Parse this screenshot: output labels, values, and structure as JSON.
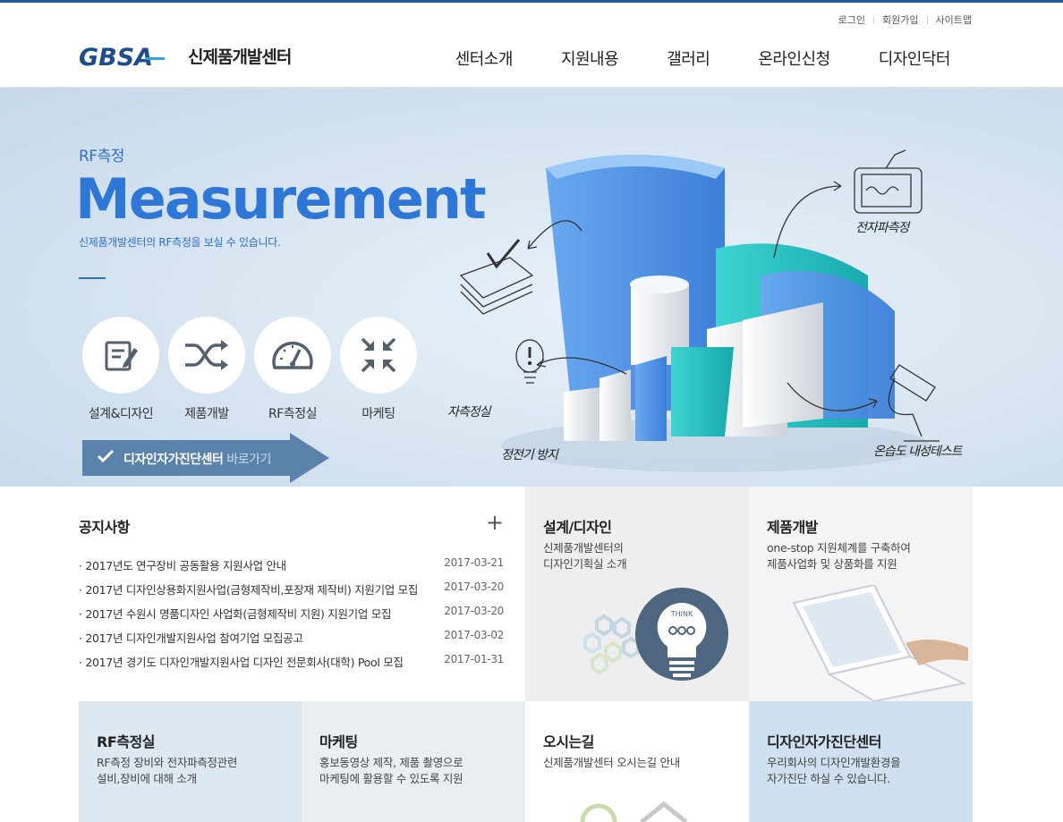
{
  "util_links": [
    "로그인",
    "회원가입",
    "사이트맵"
  ],
  "logo": {
    "mark": "GBSA",
    "text": "신제품개발센터"
  },
  "nav": [
    "센터소개",
    "지원내용",
    "갤러리",
    "온라인신청",
    "디자인닥터"
  ],
  "hero": {
    "subtitle": "RF측정",
    "title": "Measurement",
    "desc": "신제품개발센터의 RF측정을 보실 수 있습니다.",
    "quick": [
      {
        "label": "설계&디자인",
        "icon": "edit-icon"
      },
      {
        "label": "제품개발",
        "icon": "shuffle-icon"
      },
      {
        "label": "RF측정실",
        "icon": "gauge-icon"
      },
      {
        "label": "마케팅",
        "icon": "compress-icon"
      }
    ],
    "golink": {
      "strong": "디자인자가진단센터",
      "light": "바로가기"
    },
    "illustration_labels": [
      "자측정실",
      "전자파측정",
      "정전기 방지",
      "온습도 내성테스트"
    ]
  },
  "notice": {
    "title": "공지사항",
    "more": "+",
    "items": [
      {
        "title": "· 2017년도 연구장비 공동활용 지원사업 안내",
        "date": "2017-03-21"
      },
      {
        "title": "· 2017년 디자인상용화지원사업(금형제작비,포장재 제작비) 지원기업 모집",
        "date": "2017-03-20"
      },
      {
        "title": "· 2017년 수원시 명품디자인 사업화(금형제작비 지원) 지원기업 모집",
        "date": "2017-03-20"
      },
      {
        "title": "· 2017년 디자인개발지원사업 참여기업 모집공고",
        "date": "2017-03-02"
      },
      {
        "title": "· 2017년 경기도 디자인개발지원사업 디자인 전문회사(대학) Pool 모집",
        "date": "2017-01-31"
      }
    ]
  },
  "tiles": [
    {
      "title": "설계/디자인",
      "desc": "신제품개발센터의\n디자인기획실 소개",
      "bg": "#eeeeee",
      "art_text": "THINK"
    },
    {
      "title": "제품개발",
      "desc": "one-stop 지원체계를 구축하여\n제품사업화 및 상품화를 지원",
      "bg": "#f4f4f4"
    },
    {
      "title": "RF측정실",
      "desc": "RF측정 장비와 전자파측정관련\n설비,장비에 대해 소개",
      "bg": "#dde8f1"
    },
    {
      "title": "마케팅",
      "desc": "홍보동영상 제작, 제품 촬영으로\n마케팅에 활용할 수 있도록 지원",
      "bg": "#e9eef3"
    },
    {
      "title": "오시는길",
      "desc": "신제품개발센터 오시는길 안내",
      "bg": "#ffffff"
    },
    {
      "title": "디자인자가진단센터",
      "desc": "우리회사의 디자인개발환경을\n자가진단 하실 수 있습니다.",
      "bg": "#cfe0f0"
    }
  ],
  "colors": {
    "brand": "#1f5aa8",
    "hero_text": "#2f77d6",
    "golink": "#5b82ab"
  }
}
